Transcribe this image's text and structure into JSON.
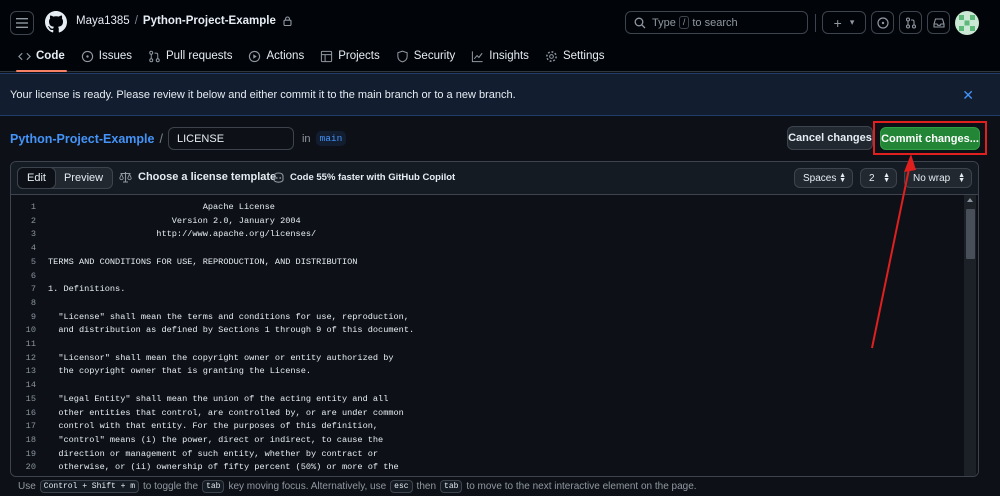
{
  "header": {
    "owner": "Maya1385",
    "separator": "/",
    "repo": "Python-Project-Example",
    "search": {
      "prefix": "Type",
      "key": "/",
      "suffix": "to search"
    },
    "plus_label": "+",
    "caret_label": "▾"
  },
  "repo_nav": {
    "tabs": [
      {
        "label": "Code",
        "icon": "code-icon"
      },
      {
        "label": "Issues",
        "icon": "issue-icon"
      },
      {
        "label": "Pull requests",
        "icon": "pull-request-icon"
      },
      {
        "label": "Actions",
        "icon": "play-icon"
      },
      {
        "label": "Projects",
        "icon": "table-icon"
      },
      {
        "label": "Security",
        "icon": "shield-icon"
      },
      {
        "label": "Insights",
        "icon": "graph-icon"
      },
      {
        "label": "Settings",
        "icon": "gear-icon"
      }
    ]
  },
  "flash": {
    "message": "Your license is ready. Please review it below and either commit it to the main branch or to a new branch.",
    "close": "✕"
  },
  "path": {
    "repo": "Python-Project-Example",
    "slash": "/",
    "filename": "LICENSE",
    "in_label": "in",
    "branch": "main"
  },
  "actions": {
    "cancel": "Cancel changes",
    "commit": "Commit changes..."
  },
  "editor": {
    "tab_edit": "Edit",
    "tab_preview": "Preview",
    "template_label": "Choose a license template",
    "copilot_label": "Code 55% faster with GitHub Copilot",
    "indent_mode": "Spaces",
    "indent_size": "2",
    "wrap_mode": "No wrap",
    "lines": [
      {
        "n": "1",
        "text": "                              Apache License"
      },
      {
        "n": "2",
        "text": "                        Version 2.0, January 2004"
      },
      {
        "n": "3",
        "text": "                     http://www.apache.org/licenses/"
      },
      {
        "n": "4",
        "text": ""
      },
      {
        "n": "5",
        "text": "TERMS AND CONDITIONS FOR USE, REPRODUCTION, AND DISTRIBUTION"
      },
      {
        "n": "6",
        "text": ""
      },
      {
        "n": "7",
        "text": "1. Definitions."
      },
      {
        "n": "8",
        "text": ""
      },
      {
        "n": "9",
        "text": "  \"License\" shall mean the terms and conditions for use, reproduction,"
      },
      {
        "n": "10",
        "text": "  and distribution as defined by Sections 1 through 9 of this document."
      },
      {
        "n": "11",
        "text": ""
      },
      {
        "n": "12",
        "text": "  \"Licensor\" shall mean the copyright owner or entity authorized by"
      },
      {
        "n": "13",
        "text": "  the copyright owner that is granting the License."
      },
      {
        "n": "14",
        "text": ""
      },
      {
        "n": "15",
        "text": "  \"Legal Entity\" shall mean the union of the acting entity and all"
      },
      {
        "n": "16",
        "text": "  other entities that control, are controlled by, or are under common"
      },
      {
        "n": "17",
        "text": "  control with that entity. For the purposes of this definition,"
      },
      {
        "n": "18",
        "text": "  \"control\" means (i) the power, direct or indirect, to cause the"
      },
      {
        "n": "19",
        "text": "  direction or management of such entity, whether by contract or"
      },
      {
        "n": "20",
        "text": "  otherwise, or (ii) ownership of fifty percent (50%) or more of the"
      }
    ]
  },
  "hint": {
    "use": "Use",
    "k1": "Control + Shift + m",
    "mid1": "to toggle the",
    "k2": "tab",
    "mid2": "key moving focus. Alternatively, use",
    "k3": "esc",
    "mid3": "then",
    "k4": "tab",
    "end": "to move to the next interactive element on the page."
  },
  "colors": {
    "accent_green": "#238636",
    "link_blue": "#4493f8",
    "annotation_red": "#e01f1f",
    "background": "#0d1117"
  }
}
